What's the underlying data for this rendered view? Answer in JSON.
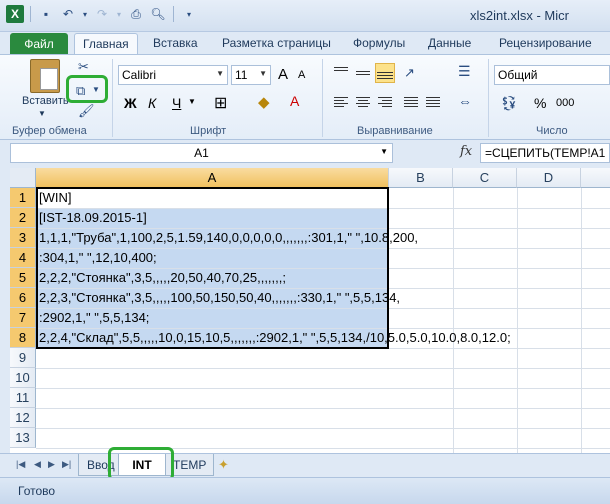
{
  "window": {
    "title": "xls2int.xlsx - Micr"
  },
  "ribbon_tabs": [
    "Файл",
    "Главная",
    "Вставка",
    "Разметка страницы",
    "Формулы",
    "Данные",
    "Рецензирование"
  ],
  "ribbon": {
    "paste_label": "Вставить",
    "clipboard_group": "Буфер обмена",
    "font_group": "Шрифт",
    "align_group": "Выравнивание",
    "number_group": "Число",
    "font_name": "Calibri",
    "font_size": "11",
    "number_format": "Общий",
    "bold": "Ж",
    "italic": "К",
    "underline": "Ч",
    "grow_font": "A",
    "shrink_font": "A",
    "font_color_letter": "A",
    "percent": "%",
    "comma": "000"
  },
  "formula_bar": {
    "cell_ref": "A1",
    "fx": "fx",
    "formula": "=СЦЕПИТЬ(TEMP!A1"
  },
  "grid": {
    "columns": [
      "A",
      "B",
      "C",
      "D"
    ],
    "rows": [
      "1",
      "2",
      "3",
      "4",
      "5",
      "6",
      "7",
      "8",
      "9",
      "10",
      "11",
      "12",
      "13"
    ],
    "cells": [
      "[WIN]",
      "[IST-18.09.2015-1]",
      "1,1,1,\"Труба\",1,100,2,5,1.59,140,0,0,0,0,0,,,,,,,:301,1,\" \",10.8,200,",
      ":304,1,\" \",12,10,400;",
      "2,2,2,\"Стоянка\",3,5,,,,,20,50,40,70,25,,,,,,,;",
      "2,2,3,\"Стоянка\",3,5,,,,,100,50,150,50,40,,,,,,,:330,1,\" \",5,5,134,",
      ":2902,1,\" \",5,5,134;",
      "2,2,4,\"Склад\",5,5,,,,,10,0,15,10,5,,,,,,,:2902,1,\" \",5,5,134,/10,5.0,5.0,10.0,8.0,12.0;"
    ]
  },
  "sheet_tabs": [
    "Ввод",
    "INT",
    "TEMP"
  ],
  "active_sheet": "INT",
  "status": {
    "text": "Готово"
  },
  "colors": {
    "highlight": "#2ead35",
    "selection": "#c5d9f1",
    "file_tab": "#2a8a3e"
  }
}
